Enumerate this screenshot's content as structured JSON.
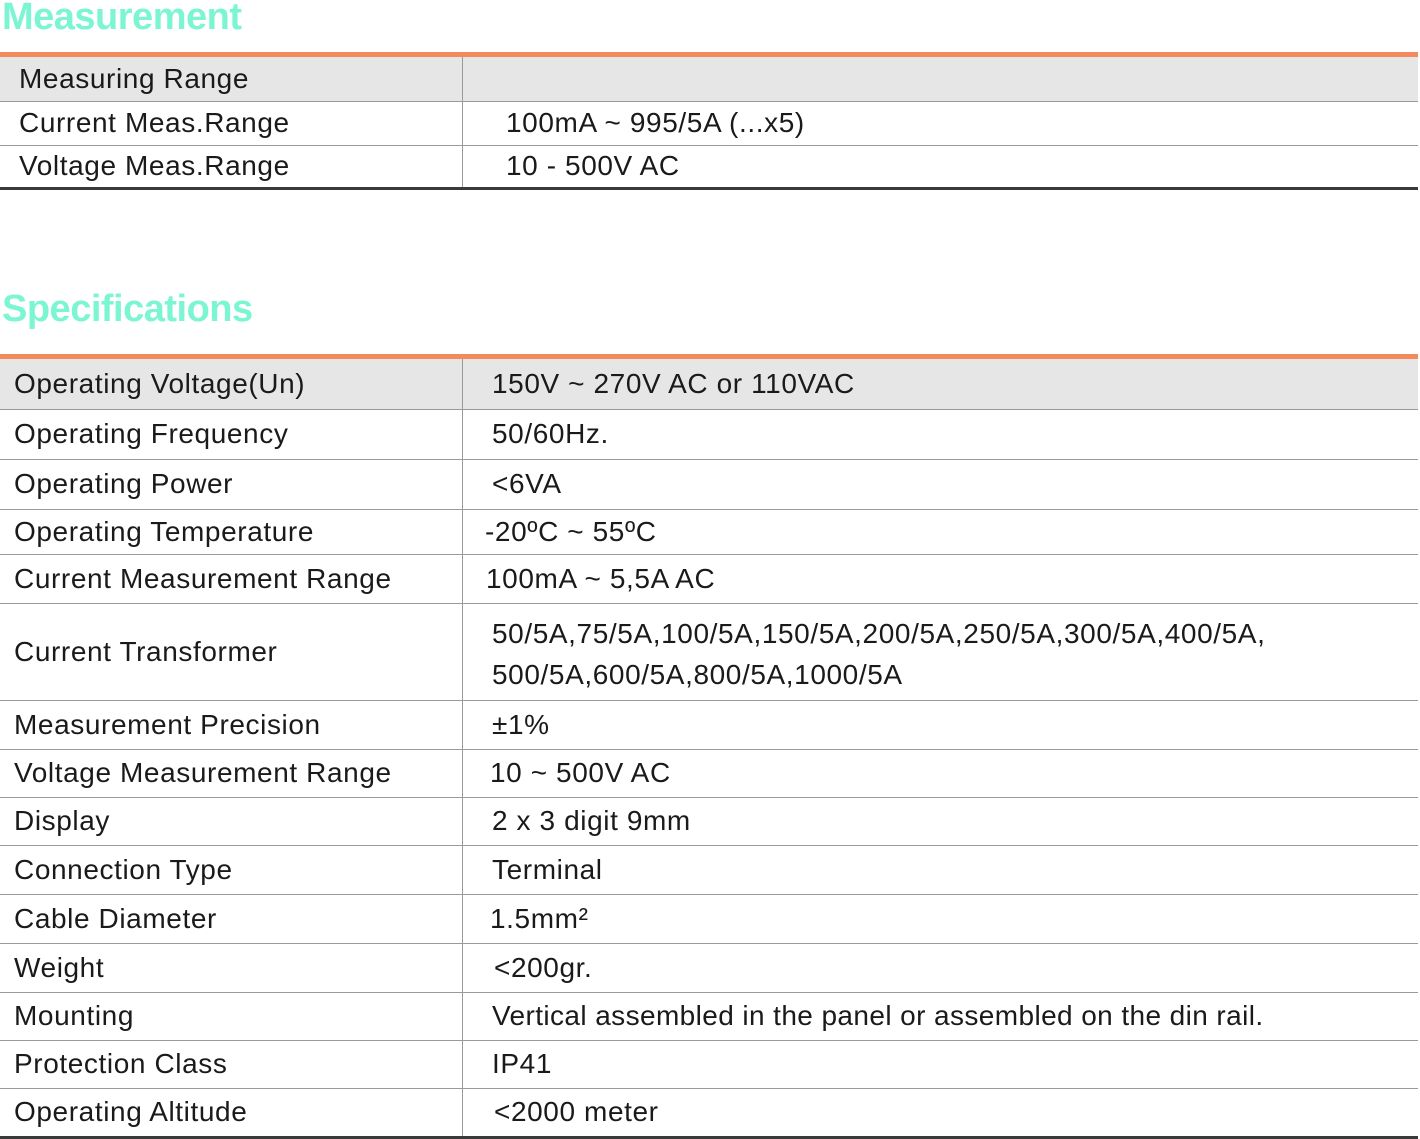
{
  "measurement": {
    "title": "Measurement",
    "rows": [
      {
        "label": "Measuring Range",
        "value": ""
      },
      {
        "label": "Current Meas.Range",
        "value": "100mA ~ 995/5A (...x5)"
      },
      {
        "label": "Voltage Meas.Range",
        "value": "10 - 500V AC"
      }
    ]
  },
  "specifications": {
    "title": "Specifications",
    "rows": [
      {
        "label": "Operating Voltage(Un)",
        "value": "150V ~ 270V AC or 110VAC"
      },
      {
        "label": "Operating Frequency",
        "value": "50/60Hz."
      },
      {
        "label": "Operating Power",
        "value": "<6VA"
      },
      {
        "label": "Operating Temperature",
        "value": "-20ºC ~ 55ºC"
      },
      {
        "label": "Current Measurement Range",
        "value": "100mA ~ 5,5A AC"
      },
      {
        "label": "Current Transformer",
        "value_line1": "50/5A,75/5A,100/5A,150/5A,200/5A,250/5A,300/5A,400/5A,",
        "value_line2": "500/5A,600/5A,800/5A,1000/5A"
      },
      {
        "label": "Measurement Precision",
        "value": "±1%"
      },
      {
        "label": "Voltage Measurement Range",
        "value": "10 ~ 500V AC"
      },
      {
        "label": "Display",
        "value": "2 x 3 digit 9mm"
      },
      {
        "label": "Connection Type",
        "value": "Terminal"
      },
      {
        "label": "Cable Diameter",
        "value": "1.5mm²"
      },
      {
        "label": "Weight",
        "value": "<200gr."
      },
      {
        "label": "Mounting",
        "value": "Vertical assembled in the panel or assembled on the din rail."
      },
      {
        "label": "Protection Class",
        "value": "IP41"
      },
      {
        "label": "Operating Altitude",
        "value": "<2000 meter"
      }
    ]
  },
  "colors": {
    "title_accent": "#7cf5d3",
    "rule_accent": "#f4895c",
    "header_row_bg": "#e6e6e6"
  }
}
